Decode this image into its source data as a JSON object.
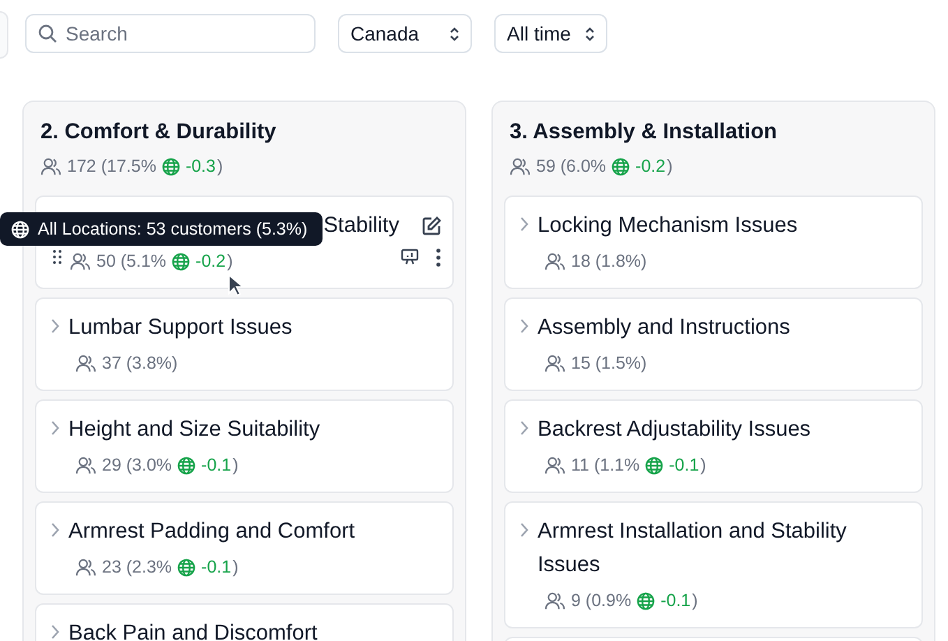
{
  "toolbar": {
    "search": {
      "placeholder": "Search"
    },
    "filters": [
      {
        "value": "Canada"
      },
      {
        "value": "All time"
      }
    ]
  },
  "columns": [
    {
      "title": "2. Comfort & Durability",
      "stat": "172 (17.5%",
      "delta": "-0.3",
      "stat_end": ")",
      "cards": [
        {
          "kind": "hovered",
          "title": "Stability",
          "stat": "50 (5.1%",
          "delta": "-0.2",
          "stat_end": ")"
        },
        {
          "kind": "plain",
          "title": "Lumbar Support Issues",
          "stat": "37 (3.8%)"
        },
        {
          "kind": "plain",
          "title": "Height and Size Suitability",
          "stat": "29 (3.0%",
          "delta": "-0.1",
          "stat_end": ")"
        },
        {
          "kind": "plain",
          "title": "Armrest Padding and Comfort",
          "stat": "23 (2.3%",
          "delta": "-0.1",
          "stat_end": ")"
        },
        {
          "kind": "plain",
          "title": "Back Pain and Discomfort"
        }
      ]
    },
    {
      "title": "3. Assembly & Installation",
      "stat": "59 (6.0%",
      "delta": "-0.2",
      "stat_end": ")",
      "cards": [
        {
          "kind": "plain",
          "title": "Locking Mechanism Issues",
          "stat": "18 (1.8%)"
        },
        {
          "kind": "plain",
          "title": "Assembly and Instructions",
          "stat": "15 (1.5%)"
        },
        {
          "kind": "plain",
          "title": "Backrest Adjustability Issues",
          "stat": "11 (1.1%",
          "delta": "-0.1",
          "stat_end": ")"
        },
        {
          "kind": "plain",
          "title": "Armrest Installation and Stability Issues",
          "stat": "9 (0.9%",
          "delta": "-0.1",
          "stat_end": ")"
        },
        {
          "kind": "plain"
        }
      ]
    }
  ],
  "tooltip": {
    "text": "All Locations: 53 customers (5.3%)"
  }
}
